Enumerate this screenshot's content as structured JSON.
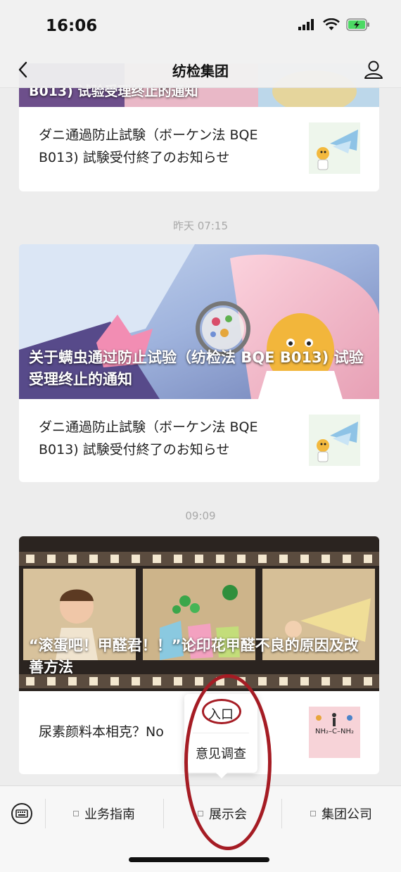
{
  "status": {
    "time": "16:06"
  },
  "nav": {
    "title": "纺检集团"
  },
  "top_card": {
    "cover_title_partial": "B013) 试验受理终止的通知",
    "sub_text": "ダニ通過防止試験（ボーケン法 BQE B013) 試験受付終了のお知らせ"
  },
  "groups": [
    {
      "time": "昨天 07:15",
      "cover_title": "关于螨虫通过防止试验（纺检法 BQE B013) 试验受理终止的通知",
      "sub_text": "ダニ通過防止試験（ボーケン法 BQE B013) 試験受付終了のお知らせ"
    },
    {
      "time": "09:09",
      "cover_title": "“滚蛋吧！甲醛君！！”论印花甲醛不良的原因及改善方法",
      "sub_text": "尿素颜料本相克？No",
      "thumb_formula": "NH₂–C–NH₂"
    }
  ],
  "popup": {
    "items": [
      "入口",
      "意见调查"
    ]
  },
  "menu": {
    "items": [
      "业务指南",
      "展示会",
      "集团公司"
    ]
  },
  "colors": {
    "annotation": "#a51c24",
    "battery": "#4cd964"
  }
}
